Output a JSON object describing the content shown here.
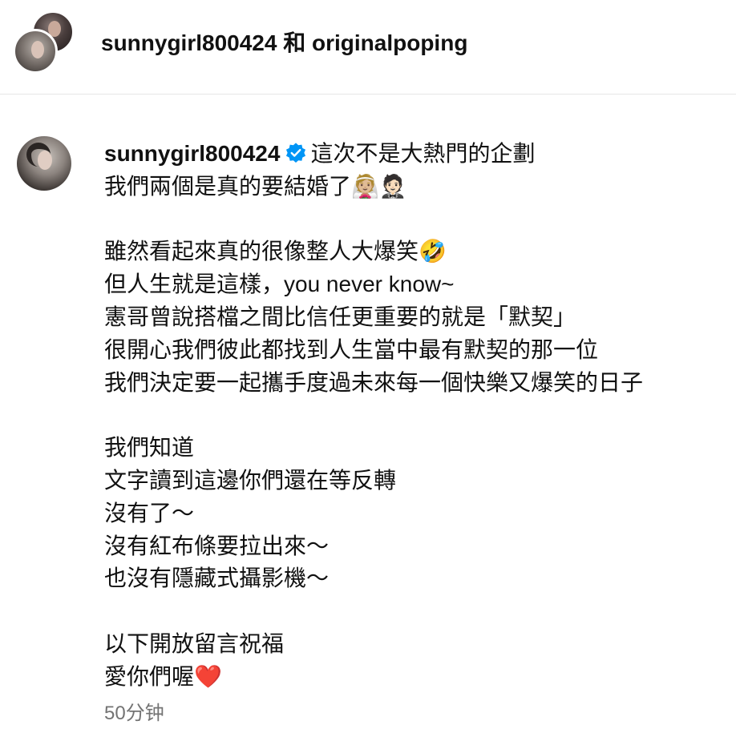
{
  "header": {
    "title": "sunnygirl800424 和 originalpoping",
    "avatars": [
      "avatar-originalpoping",
      "avatar-sunnygirl800424"
    ]
  },
  "post": {
    "username": "sunnygirl800424",
    "verified_icon": "verified-badge-icon",
    "accent_color": "#0095f6",
    "lines": [
      "這次不是大熱門的企劃",
      "我們兩個是真的要結婚了👰🏼🤵🏻",
      "",
      "雖然看起來真的很像整人大爆笑🤣",
      "但人生就是這樣，you never know~",
      "憲哥曾說搭檔之間比信任更重要的就是「默契」",
      "很開心我們彼此都找到人生當中最有默契的那一位",
      "我們決定要一起攜手度過未來每一個快樂又爆笑的日子",
      "",
      "我們知道",
      "文字讀到這邊你們還在等反轉",
      "沒有了～",
      "沒有紅布條要拉出來～",
      "也沒有隱藏式攝影機～",
      "",
      "以下開放留言祝福",
      "愛你們喔❤️"
    ],
    "timestamp": "50分钟"
  }
}
